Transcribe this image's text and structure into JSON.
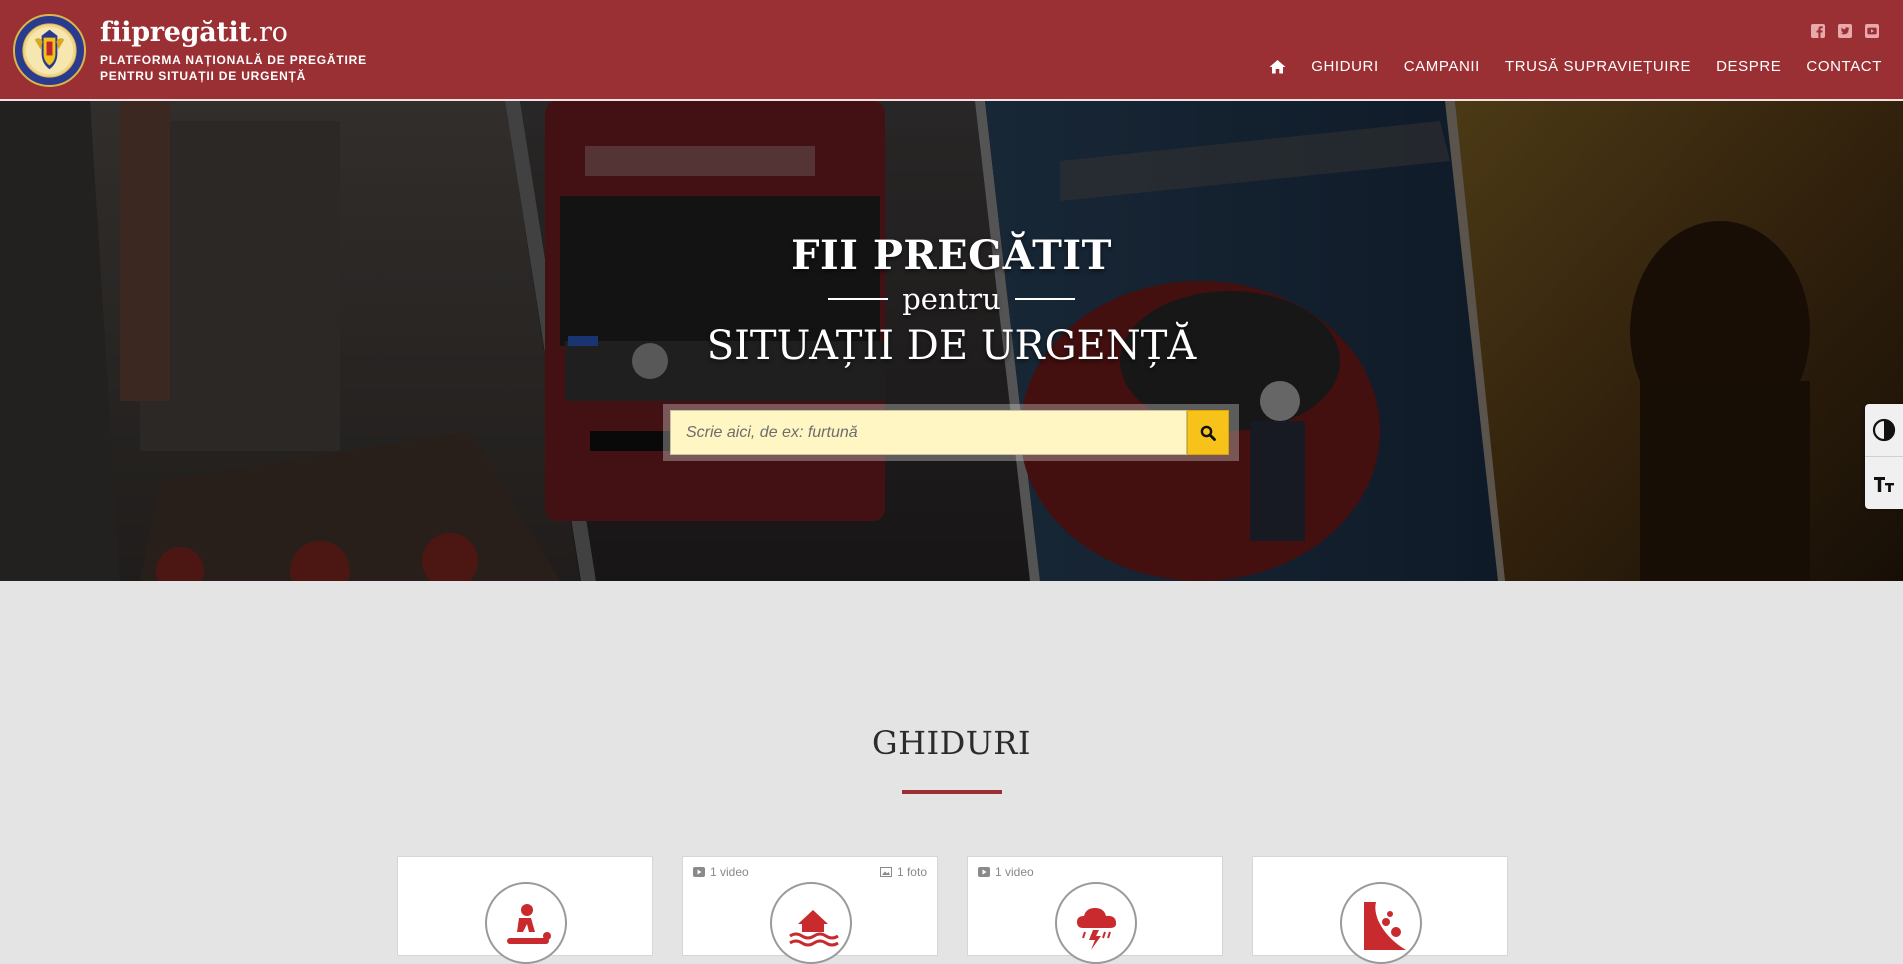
{
  "brand": {
    "name": "fiipregătit",
    "tld": ".ro",
    "tagline_1": "PLATFORMA NAȚIONALĂ DE PREGĂTIRE",
    "tagline_2": "PENTRU SITUAȚII DE URGENȚĂ"
  },
  "social": [
    "facebook-icon",
    "twitter-icon",
    "youtube-icon"
  ],
  "nav": {
    "home_icon": "home-icon",
    "items": [
      "GHIDURI",
      "CAMPANII",
      "TRUSĂ SUPRAVIEȚUIRE",
      "DESPRE",
      "CONTACT"
    ]
  },
  "hero": {
    "title": "FII PREGĂTIT",
    "subtitle": "pentru",
    "title_2": "SITUAȚII DE URGENȚĂ",
    "search_placeholder": "Scrie aici, de ex: furtună",
    "search_icon": "search-icon"
  },
  "accessibility": {
    "contrast_icon": "contrast-icon",
    "font_size_icon": "font-size-icon"
  },
  "guides": {
    "title": "GHIDURI",
    "cards": [
      {
        "icon": "cpr-icon",
        "video": "",
        "photo": ""
      },
      {
        "icon": "flood-icon",
        "video": "1 video",
        "photo": "1 foto"
      },
      {
        "icon": "storm-icon",
        "video": "1 video",
        "photo": ""
      },
      {
        "icon": "landslide-icon",
        "video": "",
        "photo": ""
      }
    ]
  },
  "colors": {
    "brand_red": "#9b3034",
    "search_bg": "#fff6c4",
    "search_button": "#f7c21a",
    "page_bg": "#e4e4e4"
  }
}
